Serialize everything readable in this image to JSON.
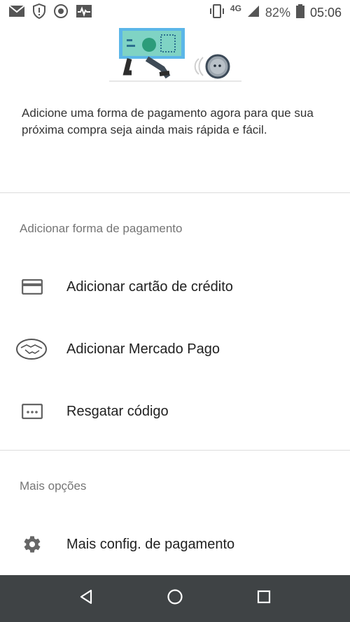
{
  "status_bar": {
    "network": "4G",
    "battery": "82%",
    "time": "05:06",
    "icons": [
      "gmail-icon",
      "shield-alert-icon",
      "sync-icon",
      "activity-icon",
      "vibrate-icon",
      "signal-icon",
      "battery-icon"
    ]
  },
  "intro_text": "Adicione uma forma de pagamento agora para que sua próxima compra seja ainda mais rápida e fácil.",
  "payment_section": {
    "title": "Adicionar forma de pagamento",
    "items": [
      {
        "label": "Adicionar cartão de crédito",
        "icon": "credit-card-icon"
      },
      {
        "label": "Adicionar Mercado Pago",
        "icon": "handshake-icon"
      },
      {
        "label": "Resgatar código",
        "icon": "code-icon"
      }
    ]
  },
  "more_section": {
    "title": "Mais opções",
    "items": [
      {
        "label": "Mais config. de pagamento",
        "icon": "gear-icon"
      }
    ]
  },
  "nav": [
    "back-icon",
    "home-icon",
    "recents-icon"
  ],
  "colors": {
    "nav_bar": "#3f4345",
    "bill_green": "#7fd3c4",
    "bill_blue": "#5bb6e8",
    "divider": "#dcdcdc"
  }
}
